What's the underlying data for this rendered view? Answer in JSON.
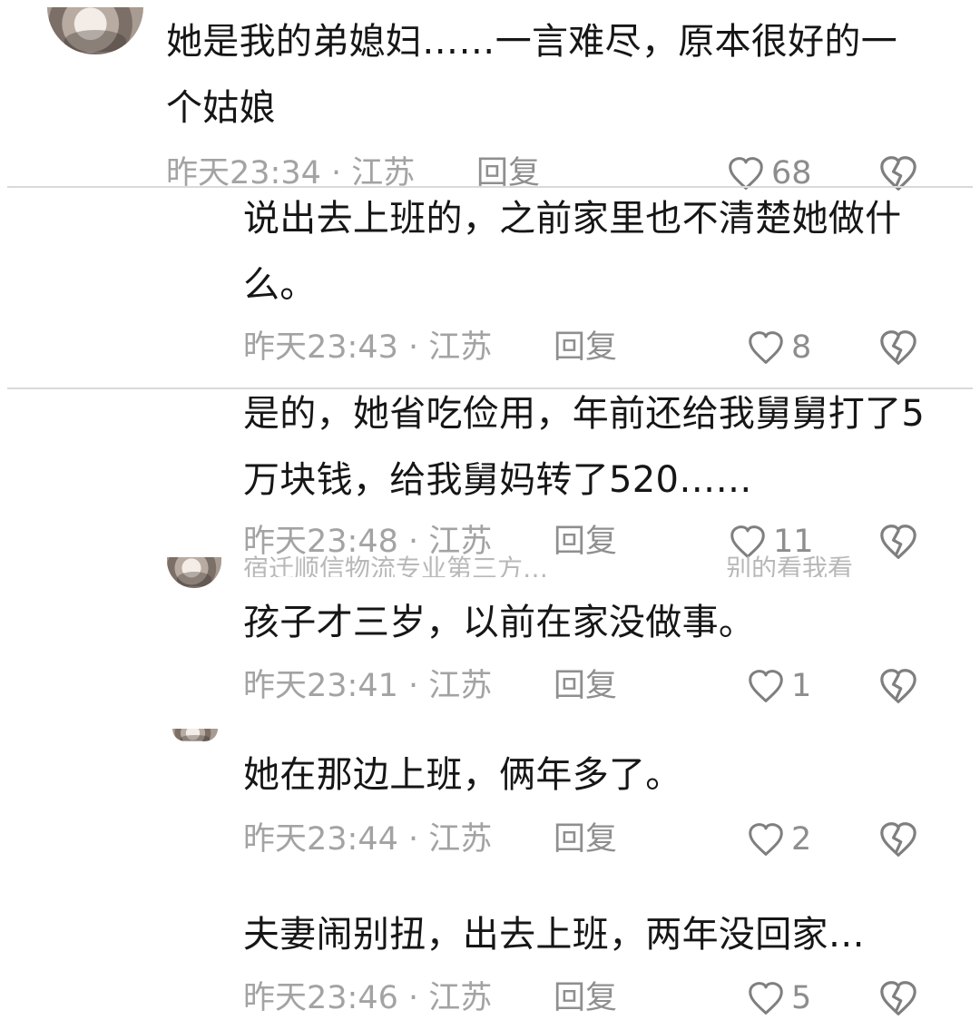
{
  "comments": [
    {
      "text": "她是我的弟媳妇……一言难尽，原本很好的一个姑娘",
      "time_location": "昨天23:34 · 江苏",
      "reply": "回复",
      "likes": "68"
    },
    {
      "text": "说出去上班的，之前家里也不清楚她做什么。",
      "time_location": "昨天23:43 · 江苏",
      "reply": "回复",
      "likes": "8"
    },
    {
      "text": "是的，她省吃俭用，年前还给我舅舅打了5万块钱，给我舅妈转了520……",
      "time_location": "昨天23:48 · 江苏",
      "reply": "回复",
      "likes": "11"
    },
    {
      "text": "孩子才三岁，以前在家没做事。",
      "time_location": "昨天23:41 · 江苏",
      "reply": "回复",
      "likes": "1"
    },
    {
      "text": "她在那边上班，俩年多了。",
      "time_location": "昨天23:44 · 江苏",
      "reply": "回复",
      "likes": "2"
    },
    {
      "text": "夫妻闹别扭，出去上班，两年没回家…",
      "time_location": "昨天23:46 · 江苏",
      "reply": "回复",
      "likes": "5"
    }
  ],
  "partial_header": "宿迁顺信物流专业第三方…",
  "partial_right": "别的看我看",
  "icons": {
    "like": "heart-icon",
    "dislike": "broken-heart-icon"
  }
}
